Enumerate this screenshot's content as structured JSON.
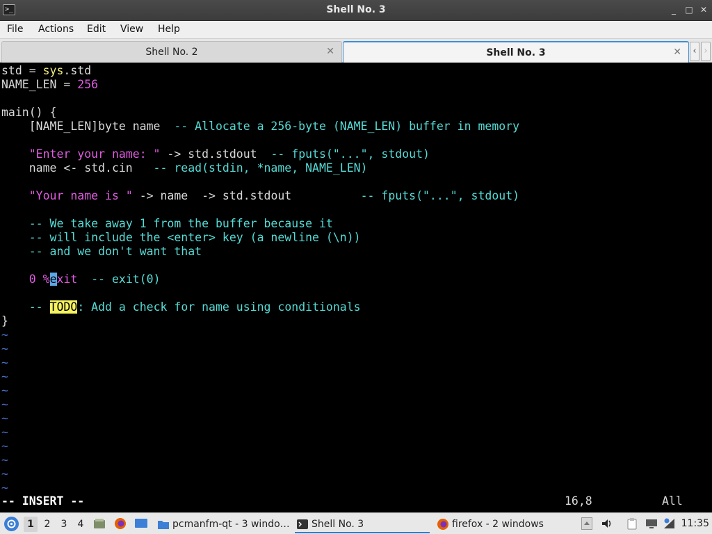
{
  "window": {
    "title": "Shell No. 3",
    "app_icon_glyph": ">_",
    "controls": {
      "minimize": "_",
      "maximize": "□",
      "close": "✕"
    }
  },
  "menu": [
    "File",
    "Actions",
    "Edit",
    "View",
    "Help"
  ],
  "tabs": [
    {
      "label": "Shell No. 2",
      "close": "✕",
      "active": false
    },
    {
      "label": "Shell No. 3",
      "close": "✕",
      "active": true
    }
  ],
  "tab_scroll": {
    "left": "‹",
    "right": "›"
  },
  "editor": {
    "lines": [
      [
        {
          "t": "std = "
        },
        {
          "t": "sys",
          "c": "kw-y"
        },
        {
          "t": ".std"
        }
      ],
      [
        {
          "t": "NAME_LEN = "
        },
        {
          "t": "256",
          "c": "num"
        }
      ],
      [],
      [
        {
          "t": "main() {"
        }
      ],
      [
        {
          "t": "    [NAME_LEN]byte name  "
        },
        {
          "t": "-- Allocate a 256-byte (NAME_LEN) buffer in memory",
          "c": "cmt"
        }
      ],
      [],
      [
        {
          "t": "    "
        },
        {
          "t": "\"Enter your name: \"",
          "c": "str"
        },
        {
          "t": " -> std.stdout  "
        },
        {
          "t": "-- fputs(\"...\", stdout)",
          "c": "cmt"
        }
      ],
      [
        {
          "t": "    name <- std.cin   "
        },
        {
          "t": "-- read(stdin, *name, NAME_LEN)",
          "c": "cmt"
        }
      ],
      [],
      [
        {
          "t": "    "
        },
        {
          "t": "\"Your name is \"",
          "c": "str"
        },
        {
          "t": " -> name  -> std.stdout          "
        },
        {
          "t": "-- fputs(\"...\", stdout)",
          "c": "cmt"
        }
      ],
      [],
      [
        {
          "t": "    "
        },
        {
          "t": "-- We take away 1 from the buffer because it",
          "c": "cmt"
        }
      ],
      [
        {
          "t": "    "
        },
        {
          "t": "-- will include the <enter> key (a newline (\\n))",
          "c": "cmt"
        }
      ],
      [
        {
          "t": "    "
        },
        {
          "t": "-- and we don't want that",
          "c": "cmt"
        }
      ],
      [],
      [
        {
          "t": "    "
        },
        {
          "t": "0",
          "c": "num"
        },
        {
          "t": " "
        },
        {
          "t": "%",
          "c": "num"
        },
        {
          "t": "e",
          "c": "cursor-cell"
        },
        {
          "t": "xit",
          "c": "num"
        },
        {
          "t": "  "
        },
        {
          "t": "-- exit(0)",
          "c": "cmt"
        }
      ],
      [],
      [
        {
          "t": "    "
        },
        {
          "t": "-- ",
          "c": "cmt"
        },
        {
          "t": "TODO",
          "c": "todo"
        },
        {
          "t": ": Add a check for name using conditionals",
          "c": "cmt"
        }
      ],
      [
        {
          "t": "}"
        }
      ]
    ],
    "tilde_rows": 12,
    "tilde_char": "~",
    "mode": "-- INSERT --",
    "position": "16,8",
    "scroll": "All"
  },
  "taskbar": {
    "workspaces": [
      "1",
      "2",
      "3",
      "4"
    ],
    "active_workspace": "1",
    "tasks": [
      {
        "label": "pcmanfm-qt - 3 windo…",
        "icon": "folder-icon",
        "active": false
      },
      {
        "label": "Shell No. 3",
        "icon": "terminal-icon",
        "active": true
      },
      {
        "label": "firefox - 2 windows",
        "icon": "firefox-icon",
        "active": false
      }
    ],
    "clock": "11:35",
    "colors": {
      "accent": "#2f7fd4",
      "firefox": "#e66000",
      "folder": "#3d7fd6"
    }
  }
}
